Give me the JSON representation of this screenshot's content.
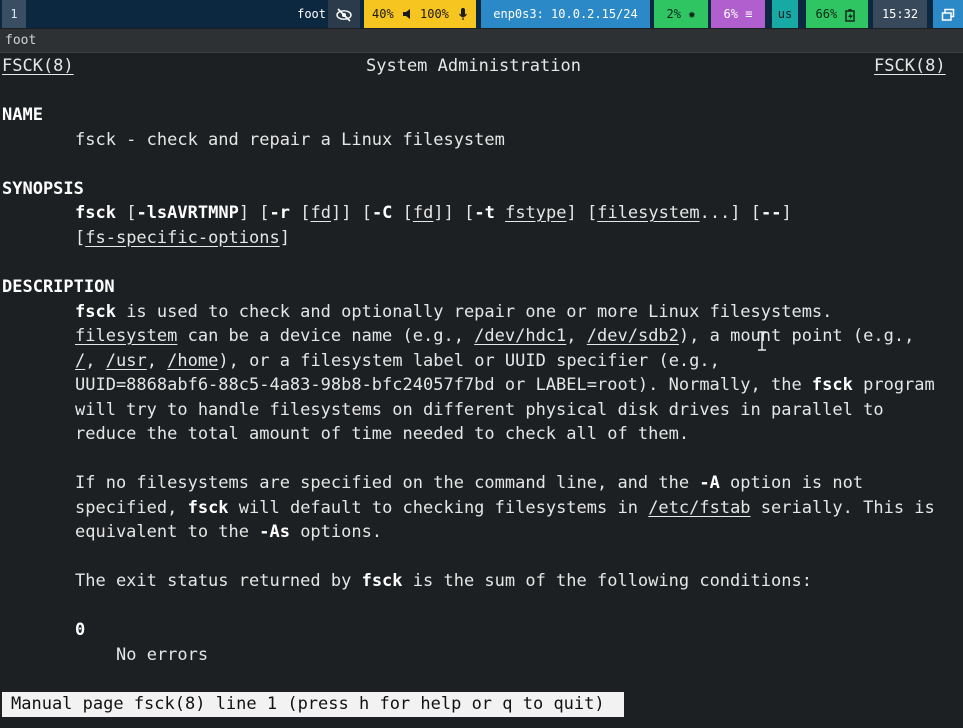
{
  "topbar": {
    "workspace": "1",
    "app_title": "foot",
    "idle_icon": "eye-slash-icon",
    "volume": "40%",
    "volume_icon": "speaker-icon",
    "mic": "100%",
    "mic_icon": "microphone-icon",
    "network": "enp0s3: 10.0.2.15/24",
    "cpu": "2%",
    "cpu_icon": "gear-icon",
    "memory": "6%",
    "memory_icon": "bars-icon",
    "language": "us",
    "battery": "66%",
    "battery_icon": "battery-charging-icon",
    "clock": "15:32",
    "scratchpad_icon": "windows-icon",
    "colors": {
      "bar_bg": "#0c2740",
      "audio": "#f7c520",
      "network": "#2c89c7",
      "cpu": "#2fc562",
      "memory": "#b15fcf",
      "language": "#17a9a3",
      "battery": "#2fc562"
    }
  },
  "window": {
    "title": "foot"
  },
  "man": {
    "header": {
      "left": "FSCK(8)",
      "center": "System Administration",
      "right": "FSCK(8)"
    },
    "name_heading": "NAME",
    "name_text": "fsck - check and repair a Linux filesystem",
    "synopsis_heading": "SYNOPSIS",
    "synopsis": {
      "cmd": "fsck",
      "o1": "[",
      "flags": "-lsAVRTMNP",
      "o2": "] [",
      "r": "-r",
      "o3": " [",
      "fd1": "fd",
      "o4": "]] [",
      "c": "-C",
      "o5": " [",
      "fd2": "fd",
      "o6": "]] [",
      "t": "-t",
      "o7": " ",
      "fstype": "fstype",
      "o8": "] [",
      "filesystem": "filesystem",
      "o9": "...] [",
      "dashdash": "--",
      "o10": "]",
      "l2_open": "[",
      "fsopts": "fs-specific-options",
      "l2_close": "]"
    },
    "description_heading": "DESCRIPTION",
    "p1": {
      "l1_cmd": "fsck",
      "l1_rest": " is used to check and optionally repair one or more Linux filesystems.",
      "l2_fs": "filesystem",
      "l2_a": " can be a device name (e.g., ",
      "l2_hdc": "/dev/hdc1",
      "l2_b": ", ",
      "l2_sdb": "/dev/sdb2",
      "l2_c": "), a mount point (e.g.,",
      "l3_root": "/",
      "l3_a": ", ",
      "l3_usr": "/usr",
      "l3_b": ", ",
      "l3_home": "/home",
      "l3_c": "), or a filesystem label or UUID specifier (e.g.,",
      "l4_a": "UUID=8868abf6-88c5-4a83-98b8-bfc24057f7bd or LABEL=root). Normally, the ",
      "l4_cmd": "fsck",
      "l4_b": " program",
      "l5": "will try to handle filesystems on different physical disk drives in parallel to",
      "l6": "reduce the total amount of time needed to check all of them."
    },
    "p2": {
      "l1_a": "If no filesystems are specified on the command line, and the ",
      "l1_opt": "-A",
      "l1_b": " option is not",
      "l2_a": "specified, ",
      "l2_cmd": "fsck",
      "l2_b": " will default to checking filesystems in ",
      "l2_path": "/etc/fstab",
      "l2_c": " serially. This is",
      "l3_a": "equivalent to the ",
      "l3_opt": "-As",
      "l3_b": " options."
    },
    "p3": {
      "a": "The exit status returned by ",
      "cmd": "fsck",
      "b": " is the sum of the following conditions:"
    },
    "exit0_code": "0",
    "exit0_text": "No errors",
    "status_line": "Manual page fsck(8) line 1 (press h for help or q to quit)"
  }
}
